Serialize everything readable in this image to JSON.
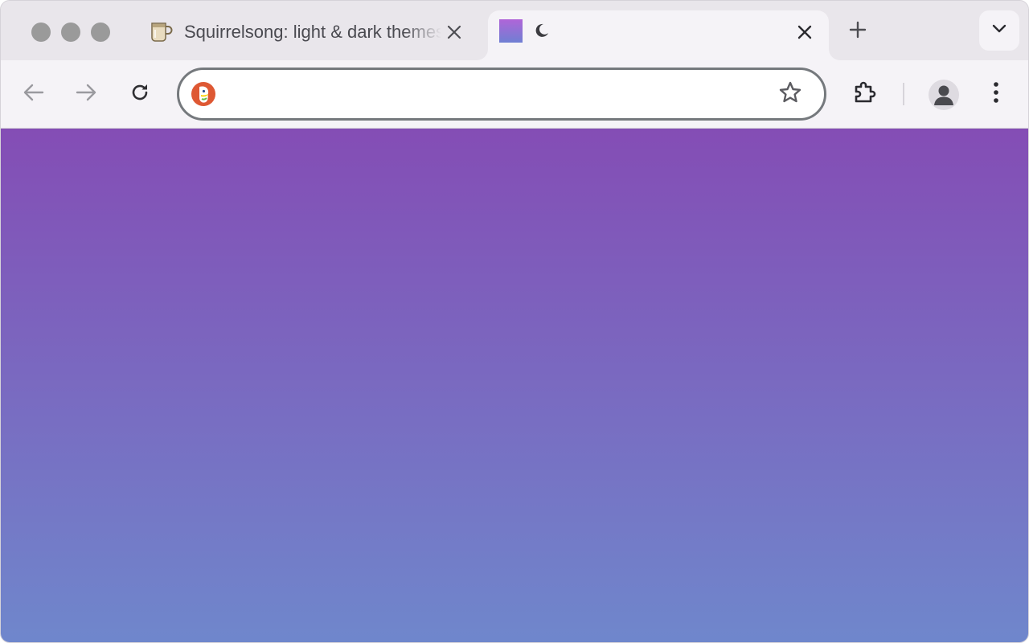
{
  "window": {
    "traffic_lights": [
      "close",
      "minimize",
      "zoom"
    ]
  },
  "tabs": [
    {
      "title": "Squirrelsong: light & dark themes",
      "favicon": "coffee-mug-icon",
      "active": false,
      "close_icon": "close-icon"
    },
    {
      "title": "",
      "favicon": "gradient-square-icon",
      "extra_icon": "moon-icon",
      "active": true,
      "close_icon": "close-icon"
    }
  ],
  "tabstrip": {
    "new_tab_icon": "plus-icon",
    "tab_search_icon": "chevron-down-icon"
  },
  "toolbar": {
    "back_icon": "arrow-left-icon",
    "forward_icon": "arrow-right-icon",
    "reload_icon": "reload-icon",
    "search_engine_icon": "duckduckgo-icon",
    "address_value": "",
    "bookmark_icon": "star-icon",
    "extensions_icon": "puzzle-piece-icon",
    "profile_icon": "person-icon",
    "menu_icon": "kebab-menu-icon"
  },
  "page": {
    "gradient_top": "#844db5",
    "gradient_bottom": "#6f87cc"
  }
}
